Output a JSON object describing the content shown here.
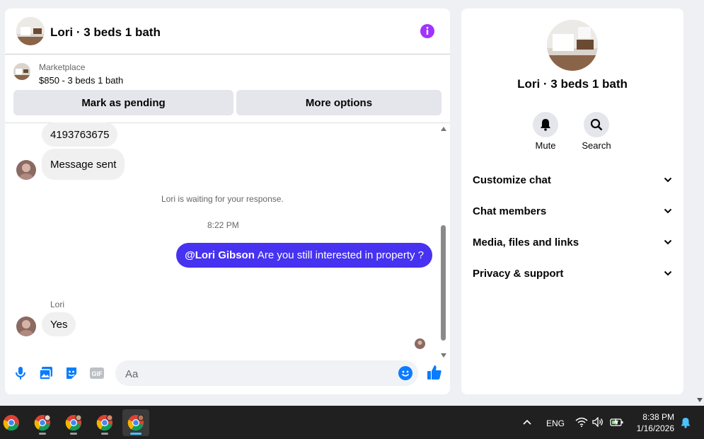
{
  "header": {
    "title": "Lori · 3 beds 1 bath",
    "info_icon": "info-icon"
  },
  "marketplace": {
    "label": "Marketplace",
    "listing": "$850 - 3 beds 1 bath",
    "mark_pending_label": "Mark as pending",
    "more_options_label": "More options"
  },
  "messages": {
    "phone_number": "4193763675",
    "message_sent": "Message sent",
    "waiting_notice": "Lori is waiting for your response.",
    "timestamp": "8:22 PM",
    "outgoing_mention": "@Lori Gibson",
    "outgoing_text": "Are you still interested in property ?",
    "sender_name": "Lori",
    "reply": "Yes"
  },
  "composer": {
    "placeholder": "Aa"
  },
  "info_panel": {
    "name": "Lori · 3 beds 1 bath",
    "mute_label": "Mute",
    "search_label": "Search",
    "sections": [
      "Customize chat",
      "Chat members",
      "Media, files and links",
      "Privacy & support"
    ]
  },
  "taskbar": {
    "language": "ENG",
    "time": "8:38 PM",
    "date": "1/16/2026"
  },
  "colors": {
    "accent": "#4632f0",
    "icon_blue": "#0a7cff",
    "info_purple": "#a033ff"
  }
}
